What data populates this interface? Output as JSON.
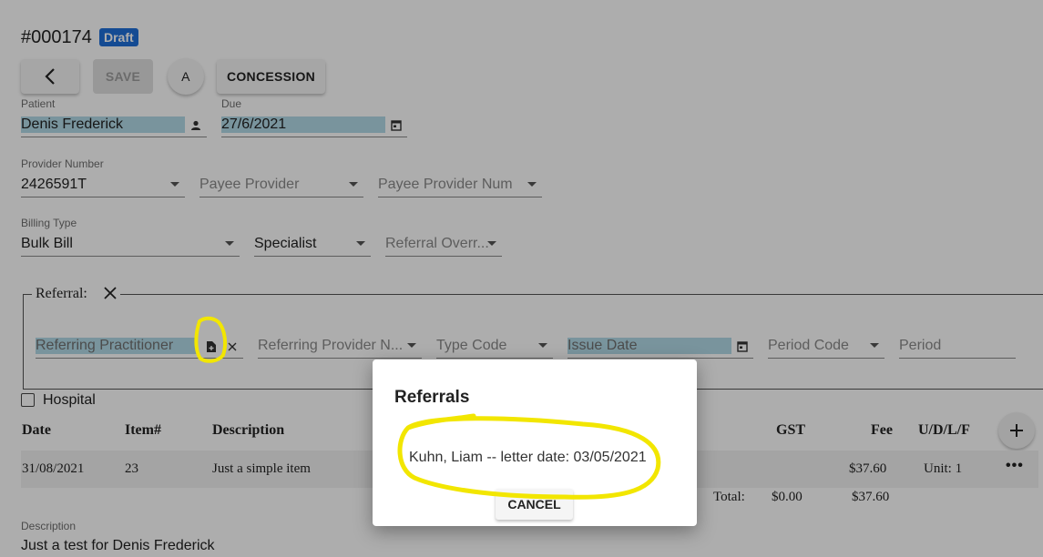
{
  "header": {
    "invoice_number": "#000174",
    "status_badge": "Draft"
  },
  "toolbar": {
    "back_icon": "chevron-left-icon",
    "save_label": "SAVE",
    "avatar_label": "A",
    "concession_label": "CONCESSION"
  },
  "patient": {
    "label": "Patient",
    "value": "Denis Frederick",
    "icon": "person-icon"
  },
  "due": {
    "label": "Due",
    "value": "27/6/2021",
    "icon": "calendar-icon"
  },
  "provider": {
    "label": "Provider Number",
    "value": "2426591T",
    "payee_provider_placeholder": "Payee Provider",
    "payee_provider_num_placeholder": "Payee Provider Num"
  },
  "billing": {
    "label": "Billing Type",
    "value": "Bulk Bill",
    "specialist_value": "Specialist",
    "referral_override_placeholder": "Referral Overr..."
  },
  "referral": {
    "legend": "Referral:",
    "close_icon": "close-icon",
    "referring_practitioner_placeholder": "Referring Practitioner",
    "referring_provider_placeholder": "Referring Provider N...",
    "type_code_placeholder": "Type Code",
    "issue_date_placeholder": "Issue Date",
    "period_code_placeholder": "Period Code",
    "period_placeholder": "Period"
  },
  "hospital_label": "Hospital",
  "table": {
    "headers": {
      "date": "Date",
      "item": "Item#",
      "description": "Description",
      "gst": "GST",
      "fee": "Fee",
      "udlf": "U/D/L/F"
    },
    "rows": [
      {
        "date": "31/08/2021",
        "item": "23",
        "description": "Just a simple item",
        "fee": "$37.60",
        "unit": "Unit: 1"
      }
    ],
    "total_label": "Total:",
    "total_gst": "$0.00",
    "total_fee": "$37.60"
  },
  "description": {
    "label": "Description",
    "value": "Just a test for Denis Frederick"
  },
  "dialog": {
    "title": "Referrals",
    "item": "Kuhn, Liam -- letter date: 03/05/2021",
    "cancel_label": "CANCEL"
  },
  "colors": {
    "badge": "#1e6fd9",
    "highlight": "#b3dbe8",
    "annotation": "#f2e600"
  }
}
